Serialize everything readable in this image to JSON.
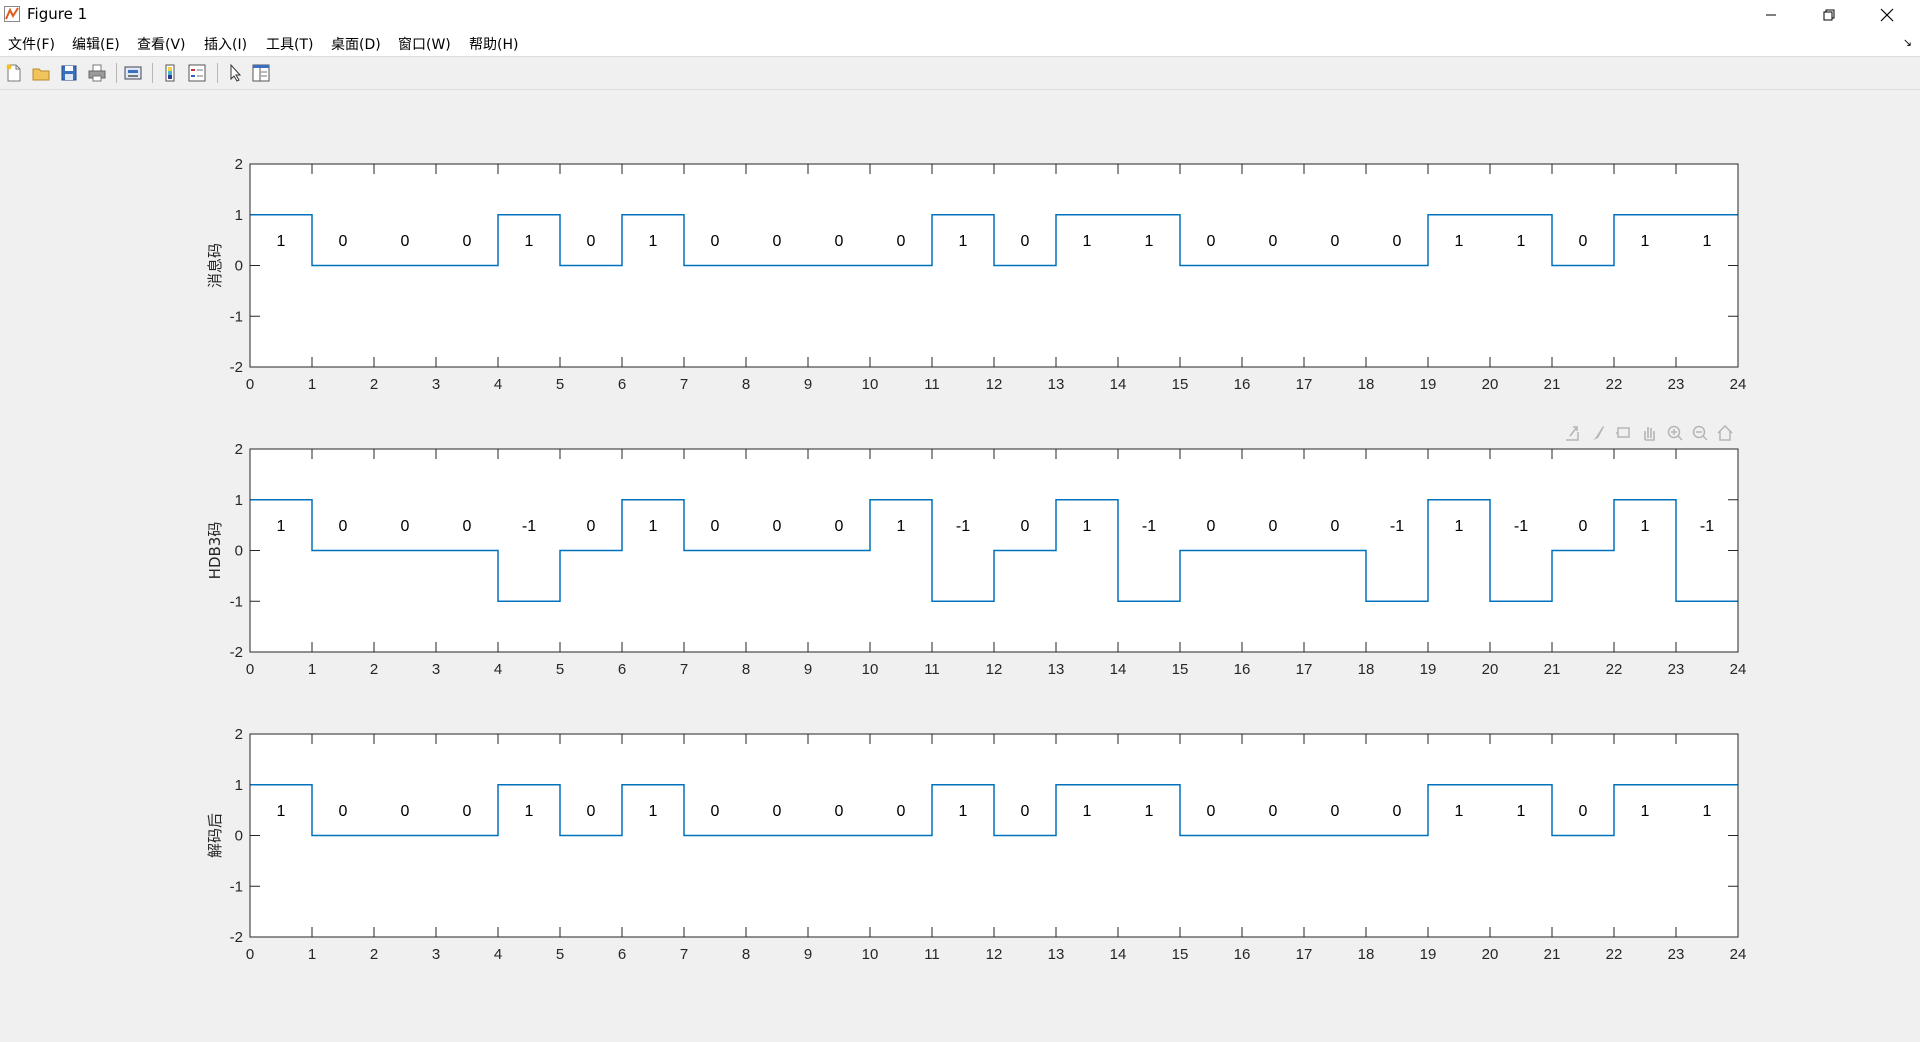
{
  "window": {
    "title": "Figure 1",
    "icons": {
      "app": "matlab-figure-icon",
      "minimize": "minimize-icon",
      "restore": "restore-icon",
      "close": "close-icon"
    }
  },
  "menubar": {
    "items": [
      "文件(F)",
      "编辑(E)",
      "查看(V)",
      "插入(I)",
      "工具(T)",
      "桌面(D)",
      "窗口(W)",
      "帮助(H)"
    ],
    "dock_arrow": "↘"
  },
  "toolbar": {
    "icons": [
      "new-figure-icon",
      "open-file-icon",
      "save-icon",
      "print-icon",
      "print-preview-icon",
      "colorbar-icon",
      "legend-icon",
      "edit-plot-arrow-icon",
      "property-inspector-icon"
    ]
  },
  "axes_toolbar": {
    "icons": [
      "export-icon",
      "brush-icon",
      "datatip-icon",
      "pan-icon",
      "zoom-in-icon",
      "zoom-out-icon",
      "home-icon"
    ]
  },
  "chart_data": [
    {
      "type": "line",
      "ylabel": "消息码",
      "xlim": [
        0,
        24
      ],
      "ylim": [
        -2,
        2
      ],
      "xticks": [
        0,
        1,
        2,
        3,
        4,
        5,
        6,
        7,
        8,
        9,
        10,
        11,
        12,
        13,
        14,
        15,
        16,
        17,
        18,
        19,
        20,
        21,
        22,
        23,
        24
      ],
      "yticks": [
        -2,
        -1,
        0,
        1,
        2
      ],
      "line_color": "#0072bd",
      "step": "post",
      "values": [
        1,
        0,
        0,
        0,
        1,
        0,
        1,
        0,
        0,
        0,
        0,
        1,
        0,
        1,
        1,
        0,
        0,
        0,
        0,
        1,
        1,
        0,
        1,
        1
      ],
      "bit_labels": [
        "1",
        "0",
        "0",
        "0",
        "1",
        "0",
        "1",
        "0",
        "0",
        "0",
        "0",
        "1",
        "0",
        "1",
        "1",
        "0",
        "0",
        "0",
        "0",
        "1",
        "1",
        "0",
        "1",
        "1"
      ]
    },
    {
      "type": "line",
      "ylabel": "HDB3码",
      "xlim": [
        0,
        24
      ],
      "ylim": [
        -2,
        2
      ],
      "xticks": [
        0,
        1,
        2,
        3,
        4,
        5,
        6,
        7,
        8,
        9,
        10,
        11,
        12,
        13,
        14,
        15,
        16,
        17,
        18,
        19,
        20,
        21,
        22,
        23,
        24
      ],
      "yticks": [
        -2,
        -1,
        0,
        1,
        2
      ],
      "line_color": "#0072bd",
      "step": "post",
      "values": [
        1,
        0,
        0,
        0,
        -1,
        0,
        1,
        0,
        0,
        0,
        1,
        -1,
        0,
        1,
        -1,
        0,
        0,
        0,
        -1,
        1,
        -1,
        0,
        1,
        -1
      ],
      "bit_labels": [
        "1",
        "0",
        "0",
        "0",
        "-1",
        "0",
        "1",
        "0",
        "0",
        "0",
        "1",
        "-1",
        "0",
        "1",
        "-1",
        "0",
        "0",
        "0",
        "-1",
        "1",
        "-1",
        "0",
        "1",
        "-1"
      ]
    },
    {
      "type": "line",
      "ylabel": "解码后",
      "xlim": [
        0,
        24
      ],
      "ylim": [
        -2,
        2
      ],
      "xticks": [
        0,
        1,
        2,
        3,
        4,
        5,
        6,
        7,
        8,
        9,
        10,
        11,
        12,
        13,
        14,
        15,
        16,
        17,
        18,
        19,
        20,
        21,
        22,
        23,
        24
      ],
      "yticks": [
        -2,
        -1,
        0,
        1,
        2
      ],
      "line_color": "#0072bd",
      "step": "post",
      "values": [
        1,
        0,
        0,
        0,
        1,
        0,
        1,
        0,
        0,
        0,
        0,
        1,
        0,
        1,
        1,
        0,
        0,
        0,
        0,
        1,
        1,
        0,
        1,
        1
      ],
      "bit_labels": [
        "1",
        "0",
        "0",
        "0",
        "1",
        "0",
        "1",
        "0",
        "0",
        "0",
        "0",
        "1",
        "0",
        "1",
        "1",
        "0",
        "0",
        "0",
        "0",
        "1",
        "1",
        "0",
        "1",
        "1"
      ]
    }
  ]
}
